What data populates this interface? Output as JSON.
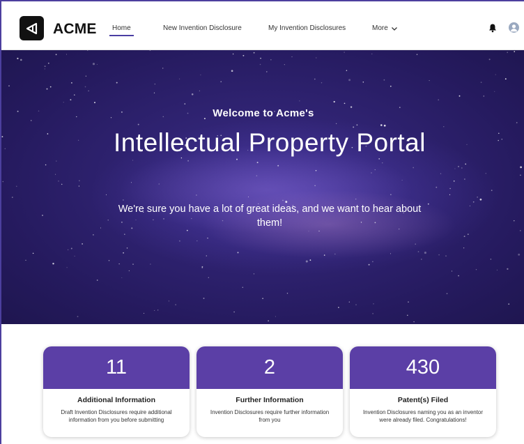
{
  "header": {
    "brand": "ACME",
    "nav": {
      "home": "Home",
      "new_disclosure": "New Invention Disclosure",
      "my_disclosures": "My Invention Disclosures",
      "more": "More"
    }
  },
  "hero": {
    "welcome": "Welcome to Acme's",
    "title": "Intellectual Property Portal",
    "subtitle": "We're sure you have a lot of great ideas, and we want to hear about them!"
  },
  "cards": [
    {
      "count": "11",
      "title": "Additional Information",
      "description": "Draft Invention Disclosures require additional information from you before submitting"
    },
    {
      "count": "2",
      "title": "Further Information",
      "description": "Invention Disclosures require further information from you"
    },
    {
      "count": "430",
      "title": "Patent(s) Filed",
      "description": "Invention Disclosures naming you as an inventor were already filed. Congratulations!"
    }
  ],
  "colors": {
    "accent": "#5b3fa6",
    "nav_underline": "#4a3ea3",
    "hero_base": "#251a5e"
  },
  "icons": [
    "acme-logo-icon",
    "chevron-down-icon",
    "bell-icon",
    "user-avatar-icon"
  ]
}
